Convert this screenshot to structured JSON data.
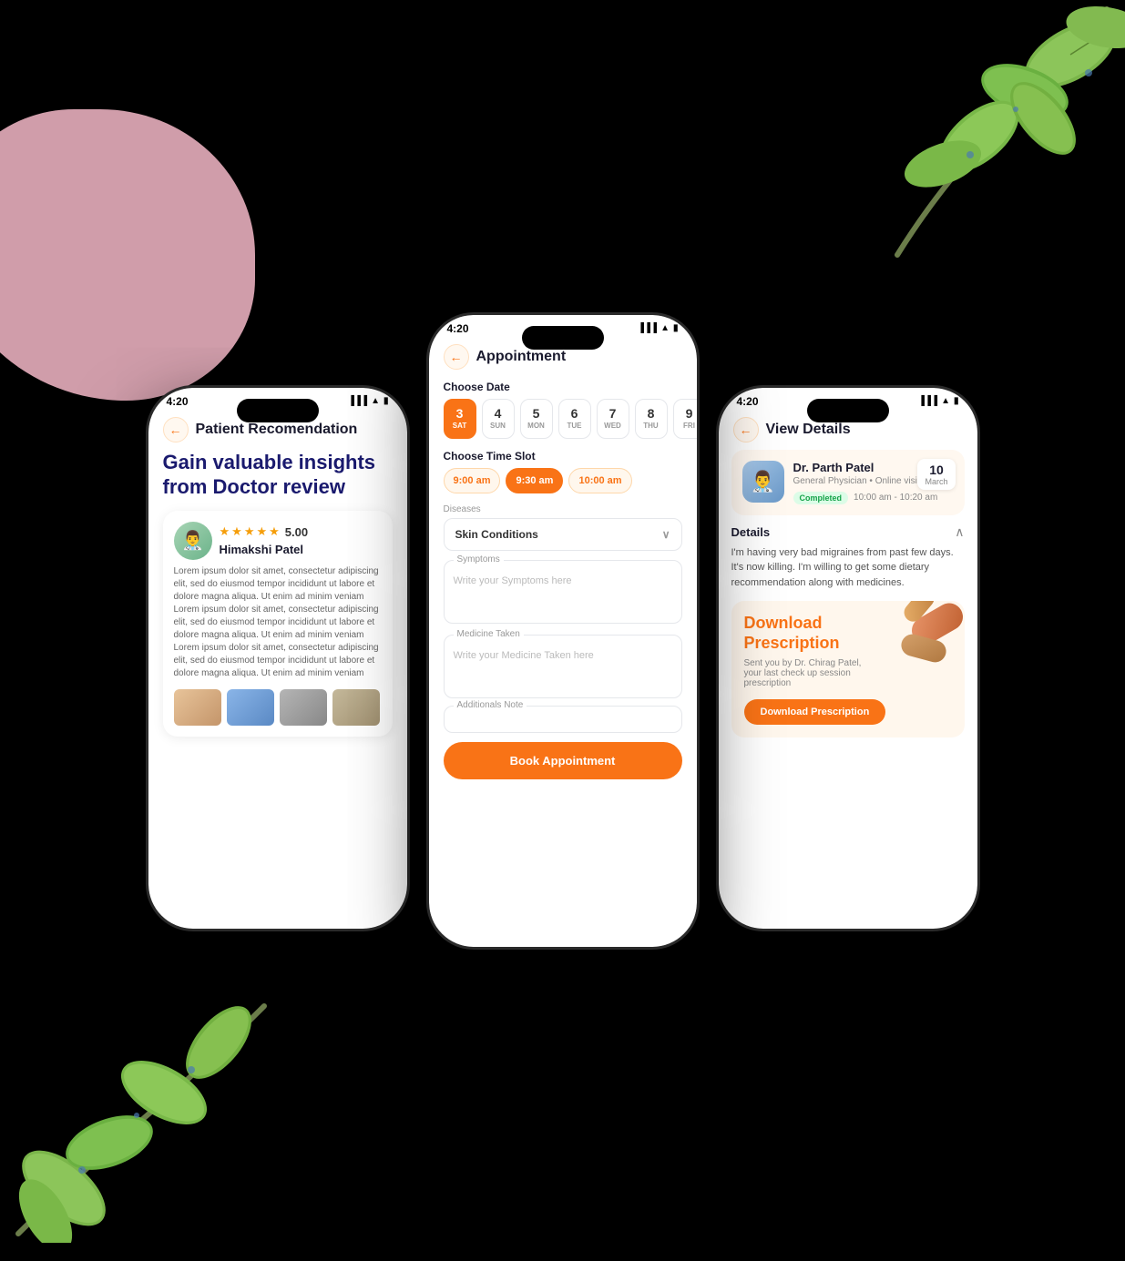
{
  "background": {
    "color": "#000000"
  },
  "left_phone": {
    "status_time": "4:20",
    "nav_title": "Patient Recomendation",
    "hero_title": "Gain valuable insights from Doctor review",
    "reviewer": {
      "name": "Himakshi Patel",
      "rating": "5.00",
      "review_text": "Lorem ipsum dolor sit amet, consectetur adipiscing elit, sed do eiusmod tempor incididunt ut labore et dolore magna aliqua. Ut enim ad minim veniam Lorem ipsum dolor sit amet, consectetur adipiscing elit, sed do eiusmod tempor incididunt ut labore et dolore magna aliqua. Ut enim ad minim veniam Lorem ipsum dolor sit amet, consectetur adipiscing elit, sed do eiusmod tempor incididunt ut labore et dolore magna aliqua. Ut enim ad minim veniam"
    }
  },
  "center_phone": {
    "status_time": "4:20",
    "nav_title": "Appointment",
    "choose_date_label": "Choose Date",
    "dates": [
      {
        "num": "3",
        "day": "SAT",
        "active": true
      },
      {
        "num": "4",
        "day": "SUN",
        "active": false
      },
      {
        "num": "5",
        "day": "MON",
        "active": false
      },
      {
        "num": "6",
        "day": "TUE",
        "active": false
      },
      {
        "num": "7",
        "day": "WED",
        "active": false
      },
      {
        "num": "8",
        "day": "THU",
        "active": false
      },
      {
        "num": "9",
        "day": "FRI",
        "active": false
      }
    ],
    "choose_time_label": "Choose Time Slot",
    "time_slots": [
      {
        "label": "9:00 am",
        "active": false
      },
      {
        "label": "9:30 am",
        "active": true
      },
      {
        "label": "10:00 am",
        "active": false
      }
    ],
    "diseases_label": "Diseases",
    "diseases_value": "Skin Conditions",
    "symptoms_label": "Symptoms",
    "symptoms_placeholder": "Write your Symptoms here",
    "medicine_label": "Medicine Taken",
    "medicine_placeholder": "Write your Medicine Taken here",
    "additional_label": "Additionals Note",
    "book_btn_label": "Book Appointment"
  },
  "right_phone": {
    "status_time": "4:20",
    "nav_title": "View Details",
    "doctor_name": "Dr. Parth Patel",
    "doctor_specialty": "General Physician • Online visit",
    "status": "Completed",
    "time_range": "10:00 am - 10:20 am",
    "date_num": "10",
    "date_month": "March",
    "details_title": "Details",
    "details_text": "I'm having very bad migraines from past few days. It's now killing. I'm willing to get some dietary recommendation along with medicines.",
    "prescription_title": "Download Prescription",
    "prescription_subtitle": "Sent you by Dr. Chirag Patel, your last check up session prescription",
    "download_btn": "Download Prescription"
  }
}
